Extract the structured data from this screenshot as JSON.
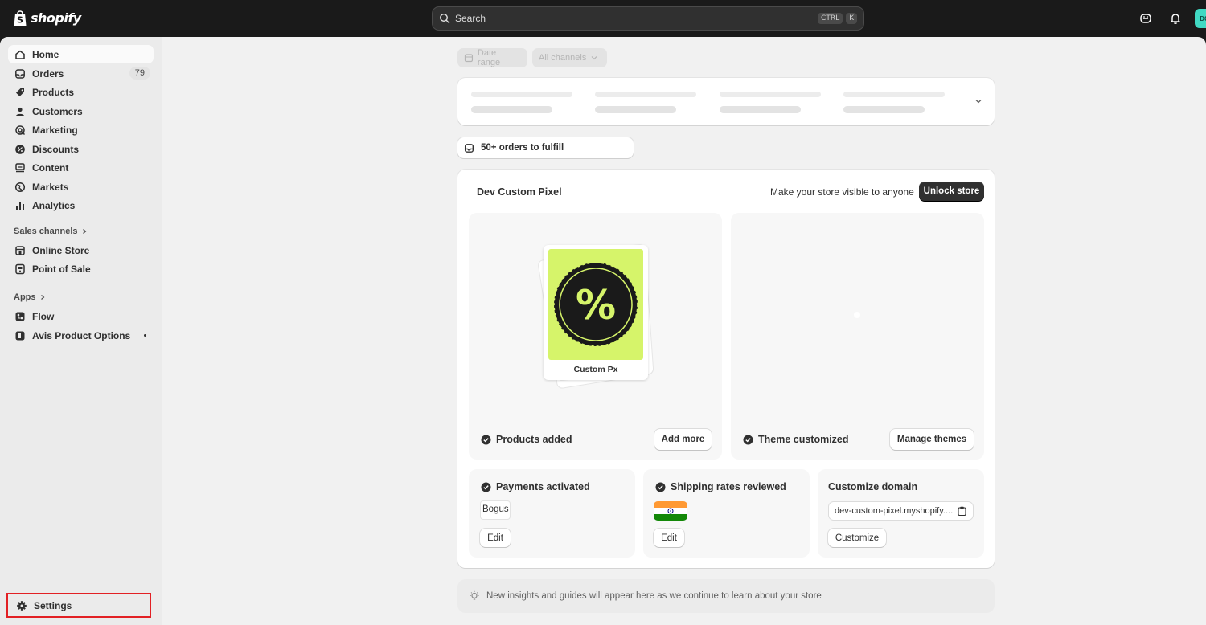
{
  "topbar": {
    "brand": "shopify",
    "search_placeholder": "Search",
    "shortcut_keys": [
      "CTRL",
      "K"
    ],
    "avatar_initials": "DC"
  },
  "sidebar": {
    "items": [
      {
        "label": "Home",
        "icon": "home-icon"
      },
      {
        "label": "Orders",
        "icon": "inbox-icon",
        "badge": "79"
      },
      {
        "label": "Products",
        "icon": "tag-icon"
      },
      {
        "label": "Customers",
        "icon": "person-icon"
      },
      {
        "label": "Marketing",
        "icon": "target-icon"
      },
      {
        "label": "Discounts",
        "icon": "discount-icon"
      },
      {
        "label": "Content",
        "icon": "content-icon"
      },
      {
        "label": "Markets",
        "icon": "globe-icon"
      },
      {
        "label": "Analytics",
        "icon": "bar-chart-icon"
      }
    ],
    "sales_channels_label": "Sales channels",
    "sales_channels": [
      {
        "label": "Online Store",
        "icon": "store-icon"
      },
      {
        "label": "Point of Sale",
        "icon": "pos-icon"
      }
    ],
    "apps_label": "Apps",
    "apps": [
      {
        "label": "Flow",
        "icon": "flow-icon"
      },
      {
        "label": "Avis Product Options",
        "icon": "app-icon"
      }
    ],
    "settings_label": "Settings"
  },
  "filters": {
    "date_range": "Date range",
    "channels": "All channels"
  },
  "fulfill": {
    "label": "50+ orders to fulfill"
  },
  "setup": {
    "store_name": "Dev Custom Pixel",
    "visibility_text": "Make your store visible to anyone",
    "unlock_button": "Unlock store",
    "product_card_label": "Custom Px",
    "products_added": "Products added",
    "add_more": "Add more",
    "theme_customized": "Theme customized",
    "manage_themes": "Manage themes",
    "payments_activated": "Payments activated",
    "payment_provider": "Bogus",
    "payments_edit": "Edit",
    "shipping_reviewed": "Shipping rates reviewed",
    "shipping_edit": "Edit",
    "customize_domain": "Customize domain",
    "domain_value": "dev-custom-pixel.myshopify....",
    "customize_button": "Customize"
  },
  "insights": {
    "text": "New insights and guides will appear here as we continue to learn about your store"
  },
  "colors": {
    "topbar": "#1a1a1a",
    "sidebar": "#ebebeb",
    "canvas": "#f1f1f1",
    "product_tile": "#d6f46a",
    "settings_highlight": "#e22024",
    "avatar": "#41d9c3"
  }
}
